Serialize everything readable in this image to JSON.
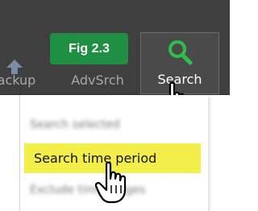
{
  "figure_tag": "Fig 2.3",
  "toolbar": {
    "buttons": [
      {
        "label": "Backup",
        "icon": "backup-icon"
      },
      {
        "label": "AdvSrch",
        "icon": "advanced-search-icon"
      },
      {
        "label": "Search",
        "icon": "search-icon",
        "state": "hovered"
      }
    ]
  },
  "menu": {
    "items": [
      {
        "label": "Search selected",
        "legible": false
      },
      {
        "label": "Search time period",
        "highlighted": true
      },
      {
        "label": "Exclude time ranges",
        "legible": false
      }
    ]
  },
  "colors": {
    "toolbar_bg": "#3f3f3f",
    "figure_tag_bg": "#1f8f43",
    "highlight_bg": "#f4ee4b",
    "search_icon": "#2fbf4f"
  }
}
